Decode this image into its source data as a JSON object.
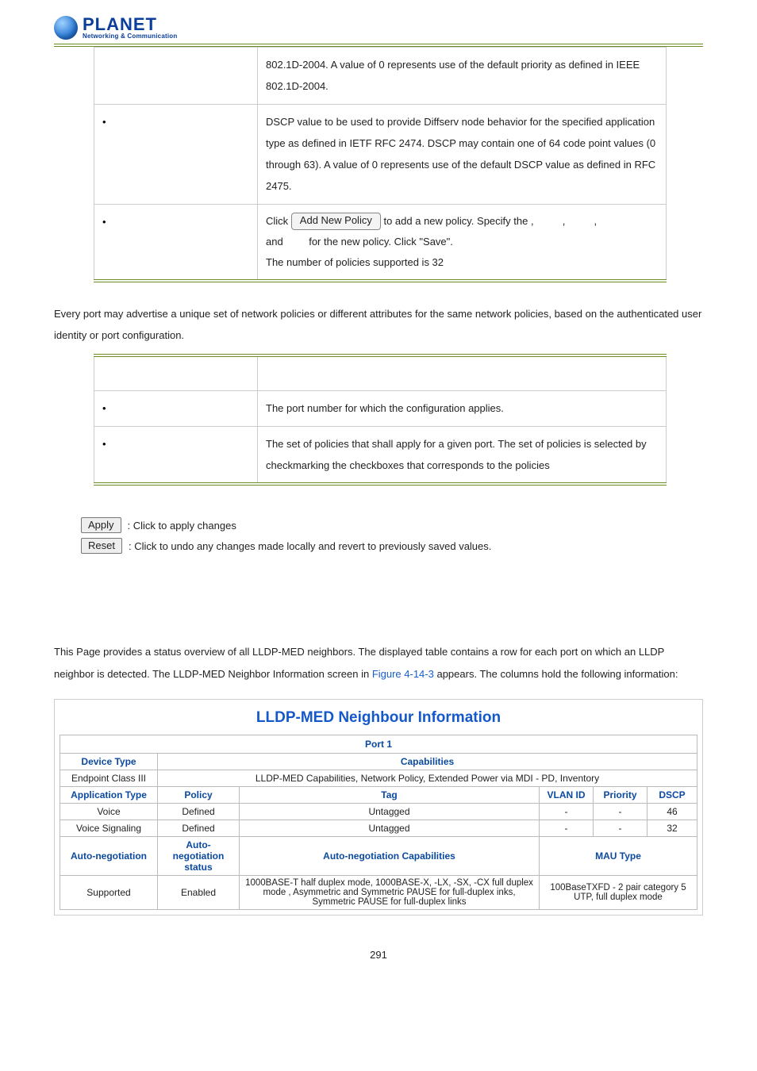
{
  "logo": {
    "name": "PLANET",
    "tagline": "Networking & Communication"
  },
  "table1": {
    "row_priority": {
      "text": "802.1D-2004. A value of 0 represents use of the default priority as defined in IEEE 802.1D-2004."
    },
    "row_dscp": {
      "text": "DSCP value to be used to provide Diffserv node behavior for the specified application type as defined in IETF RFC 2474. DSCP may contain one of 64 code point values (0 through 63). A value of 0 represents use of the default DSCP value as defined in RFC 2475."
    },
    "row_add": {
      "click": "Click",
      "btn": "Add New Policy",
      "mid1": " to add a new policy. Specify the ",
      "comma": ",",
      "mid_and": "and",
      "mid2": " for the new policy. Click \"Save\".",
      "tail": "The number of policies supported is 32"
    }
  },
  "para_ports": "Every port may advertise a unique set of network policies or different attributes for the same network policies, based on the authenticated user identity or port configuration.",
  "table2": {
    "row_port": "The port number for which the configuration applies.",
    "row_policies": "The set of policies that shall apply for a given port. The set of policies is selected by checkmarking the checkboxes that corresponds to the policies"
  },
  "buttons": {
    "apply_label": "Apply",
    "apply_text": ": Click to apply changes",
    "reset_label": "Reset",
    "reset_text": ": Click to undo any changes made locally and revert to previously saved values."
  },
  "neighbor_intro": {
    "p1a": "This Page provides a status overview of all LLDP-MED neighbors. The displayed table contains a row for each port on which an LLDP neighbor is detected. The LLDP-MED Neighbor Information screen in ",
    "link": "Figure 4-14-3",
    "p1b": " appears. The columns hold the following information:"
  },
  "figure": {
    "title": "LLDP-MED Neighbour Information",
    "port_label": "Port 1",
    "h_devtype": "Device Type",
    "h_caps": "Capabilities",
    "v_devtype": "Endpoint Class III",
    "v_caps": "LLDP-MED Capabilities, Network Policy, Extended Power via MDI - PD, Inventory",
    "h_apptype": "Application Type",
    "h_policy": "Policy",
    "h_tag": "Tag",
    "h_vlan": "VLAN ID",
    "h_prio": "Priority",
    "h_dscp": "DSCP",
    "rows_app": [
      {
        "app": "Voice",
        "policy": "Defined",
        "tag": "Untagged",
        "vlan": "-",
        "prio": "-",
        "dscp": "46"
      },
      {
        "app": "Voice Signaling",
        "policy": "Defined",
        "tag": "Untagged",
        "vlan": "-",
        "prio": "-",
        "dscp": "32"
      }
    ],
    "h_autoneg": "Auto-negotiation",
    "h_autoneg_status": "Auto-negotiation status",
    "h_autoneg_caps": "Auto-negotiation Capabilities",
    "h_mau": "MAU Type",
    "v_autoneg": "Supported",
    "v_autoneg_status": "Enabled",
    "v_autoneg_caps": "1000BASE-T half duplex mode, 1000BASE-X, -LX, -SX, -CX full duplex mode , Asymmetric and Symmetric PAUSE for full-duplex inks, Symmetric PAUSE for full-duplex links",
    "v_mau": "100BaseTXFD - 2 pair category 5 UTP, full duplex mode"
  },
  "page_number": "291"
}
